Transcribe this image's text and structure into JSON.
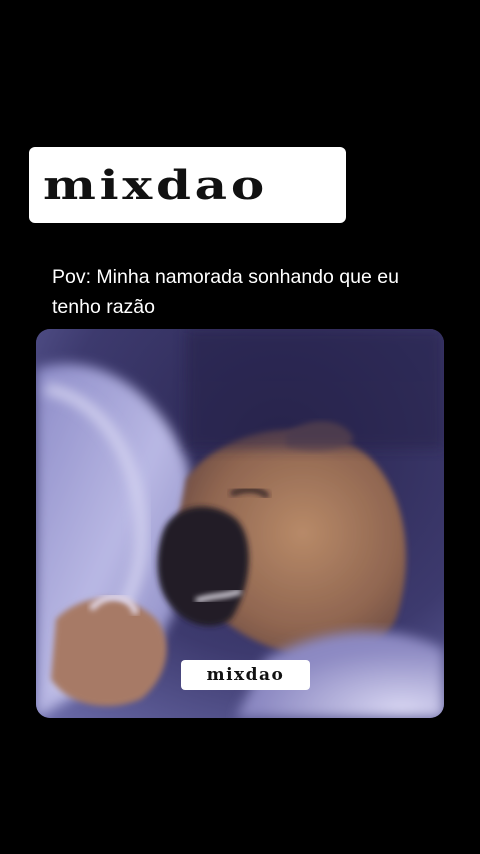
{
  "brand": {
    "logo_text": "mixdao",
    "watermark_text": "mixdao"
  },
  "post": {
    "caption": "Pov: Minha namorada sonhando que eu tenho razão"
  },
  "media": {
    "subject_icon": "sleeping-dog-photo"
  },
  "colors": {
    "background": "#000000",
    "label_bg": "#ffffff",
    "text": "#ffffff"
  }
}
